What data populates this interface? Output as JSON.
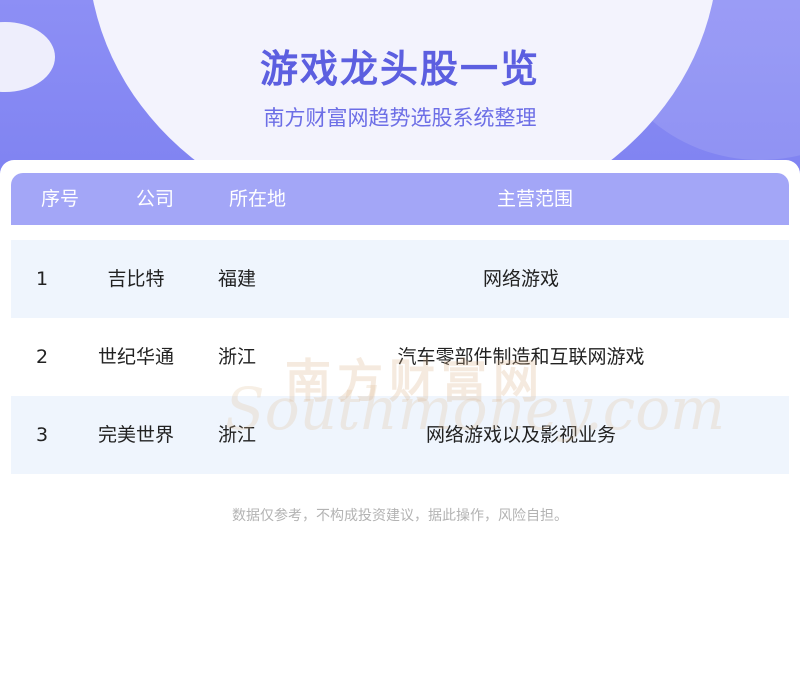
{
  "header": {
    "title": "游戏龙头股一览",
    "subtitle": "南方财富网趋势选股系统整理"
  },
  "table": {
    "columns": [
      "序号",
      "公司",
      "所在地",
      "主营范围"
    ],
    "rows": [
      {
        "num": "1",
        "company": "吉比特",
        "location": "福建",
        "business": "网络游戏"
      },
      {
        "num": "2",
        "company": "世纪华通",
        "location": "浙江",
        "business": "汽车零部件制造和互联网游戏"
      },
      {
        "num": "3",
        "company": "完美世界",
        "location": "浙江",
        "business": "网络游戏以及影视业务"
      }
    ]
  },
  "disclaimer": "数据仅参考，不构成投资建议，据此操作，风险自担。",
  "watermark": {
    "cn": "南方财富网",
    "en": "Southmoney.com"
  },
  "colors": {
    "accent": "#5c5fe0",
    "header_bg": "#8d8ff5",
    "table_head": "#a3a6f7",
    "row_alt": "#eff5fd"
  }
}
